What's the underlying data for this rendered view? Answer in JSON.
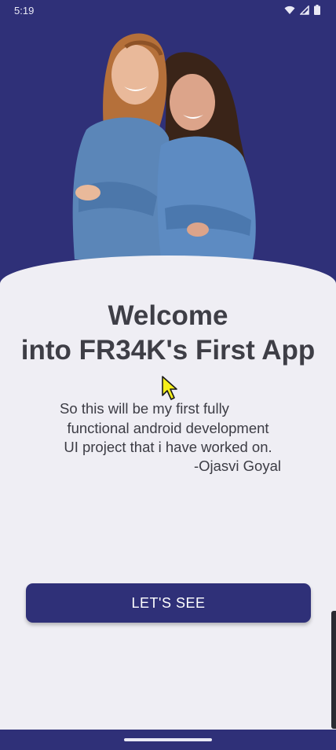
{
  "status_bar": {
    "time": "5:19",
    "icons": [
      "wifi-icon",
      "signal-icon",
      "battery-icon"
    ]
  },
  "hero": {
    "background_color": "#2f3078",
    "image": "two-women-in-denim-shirts-standing-back-to-back"
  },
  "welcome": {
    "title_line1": "Welcome",
    "title_line2": "into FR34K's First App"
  },
  "description": {
    "line1": "So this will be my first fully",
    "line2": "functional android development",
    "line3": "UI project that i have worked on.",
    "signature": "-Ojasvi Goyal"
  },
  "button": {
    "label": "LET'S SEE",
    "color": "#2f3078"
  },
  "navigation_bar": {
    "color": "#2f3078"
  }
}
